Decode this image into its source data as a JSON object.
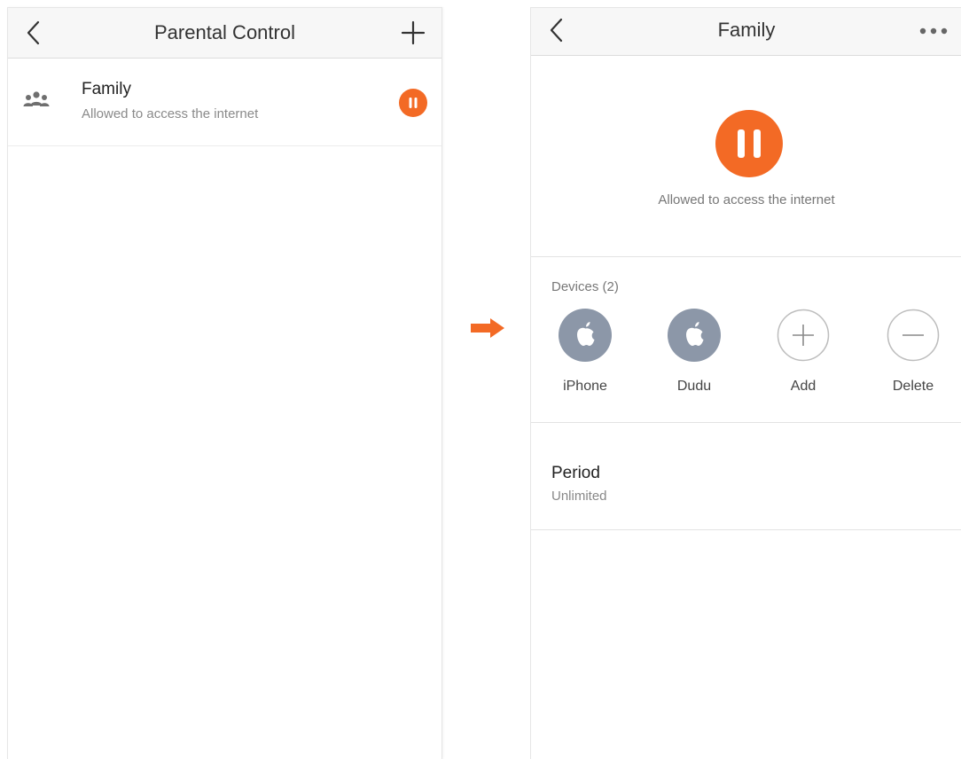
{
  "left_screen": {
    "title": "Parental Control",
    "back_icon": "chevron-left-icon",
    "add_icon": "plus-icon",
    "groups": [
      {
        "name": "Family",
        "status": "Allowed to access the internet",
        "icon": "people-group-icon",
        "action_icon": "pause-icon"
      }
    ]
  },
  "transition_arrow": {
    "icon": "arrow-right-icon",
    "color": "#f36a25"
  },
  "right_screen": {
    "title": "Family",
    "back_icon": "chevron-left-icon",
    "more_icon": "more-dots-icon",
    "status_text": "Allowed to access the internet",
    "devices_title": "Devices (2)",
    "devices": [
      {
        "label": "iPhone",
        "icon": "apple-icon"
      },
      {
        "label": "Dudu",
        "icon": "apple-icon"
      },
      {
        "label": "Add",
        "icon": "plus-circle-icon"
      },
      {
        "label": "Delete",
        "icon": "minus-circle-icon"
      }
    ],
    "period_title": "Period",
    "period_value": "Unlimited"
  },
  "colors": {
    "accent": "#f36a25",
    "device_icon_bg": "#8c97a8",
    "navbar_bg": "#f7f7f7"
  }
}
